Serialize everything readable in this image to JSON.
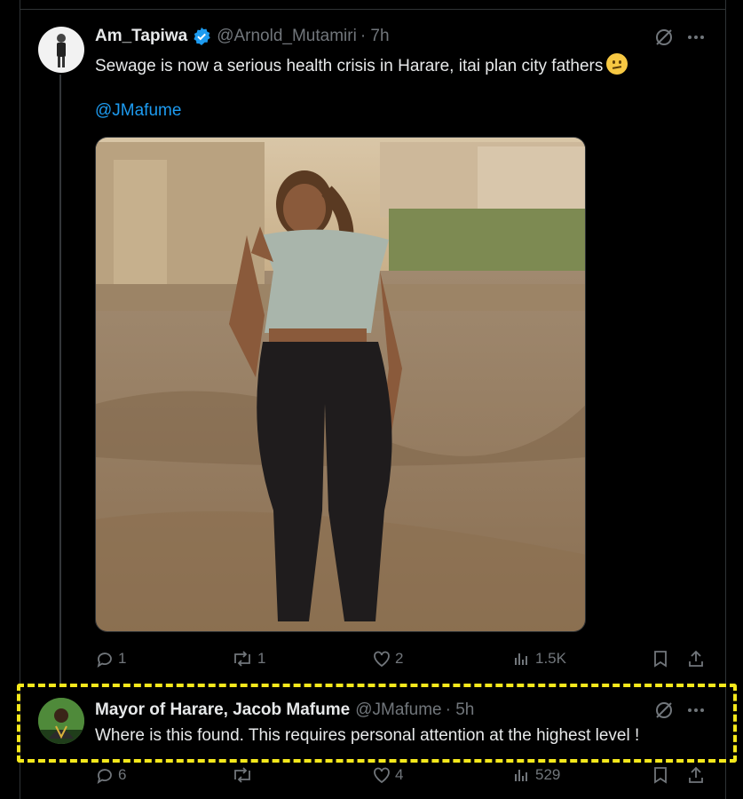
{
  "tweet": {
    "author_name": "Am_Tapiwa",
    "author_handle": "@Arnold_Mutamiri",
    "time": "· 7h",
    "text": "Sewage is now a serious health crisis in Harare, itai plan city fathers",
    "emoji": "confused-face-emoji",
    "mention": "@JMafume",
    "image": "photo-woman-posing-dirt-road",
    "actions": {
      "replies": "1",
      "reposts": "1",
      "likes": "2",
      "views": "1.5K"
    }
  },
  "reply": {
    "author_name": "Mayor of Harare, Jacob Mafume",
    "author_handle": "@JMafume",
    "time": "· 5h",
    "text": "Where is this found. This requires personal attention at the highest level !",
    "actions": {
      "replies": "6",
      "reposts": "",
      "likes": "4",
      "views": "529"
    }
  },
  "colors": {
    "background": "#000000",
    "text": "#e7e9ea",
    "muted": "#71767b",
    "link": "#1d9bf0",
    "verified": "#1d9bf0",
    "highlight": "#f5e81c"
  }
}
